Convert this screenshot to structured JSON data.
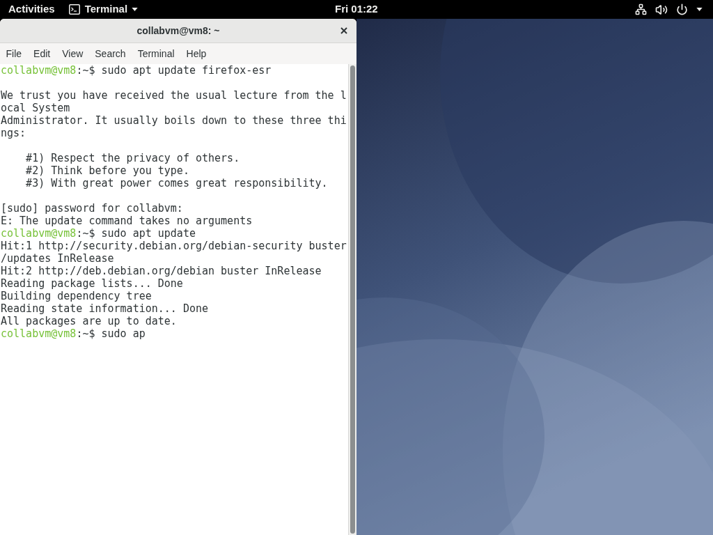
{
  "top_bar": {
    "activities": "Activities",
    "app_menu": "Terminal",
    "clock": "Fri 01:22"
  },
  "window": {
    "title": "collabvm@vm8: ~"
  },
  "menu": [
    "File",
    "Edit",
    "View",
    "Search",
    "Terminal",
    "Help"
  ],
  "terminal": {
    "lines": [
      {
        "kind": "prompt",
        "user_host": "collabvm@vm8",
        "path": ":~$",
        "command": "sudo apt update firefox-esr"
      },
      {
        "kind": "blank"
      },
      {
        "kind": "output",
        "text": "We trust you have received the usual lecture from the l"
      },
      {
        "kind": "output",
        "text": "ocal System"
      },
      {
        "kind": "output",
        "text": "Administrator. It usually boils down to these three thi"
      },
      {
        "kind": "output",
        "text": "ngs:"
      },
      {
        "kind": "blank"
      },
      {
        "kind": "output",
        "text": "    #1) Respect the privacy of others."
      },
      {
        "kind": "output",
        "text": "    #2) Think before you type."
      },
      {
        "kind": "output",
        "text": "    #3) With great power comes great responsibility."
      },
      {
        "kind": "blank"
      },
      {
        "kind": "output",
        "text": "[sudo] password for collabvm:"
      },
      {
        "kind": "output",
        "text": "E: The update command takes no arguments"
      },
      {
        "kind": "prompt",
        "user_host": "collabvm@vm8",
        "path": ":~$",
        "command": "sudo apt update"
      },
      {
        "kind": "output",
        "text": "Hit:1 http://security.debian.org/debian-security buster"
      },
      {
        "kind": "output",
        "text": "/updates InRelease"
      },
      {
        "kind": "output",
        "text": "Hit:2 http://deb.debian.org/debian buster InRelease"
      },
      {
        "kind": "output",
        "text": "Reading package lists... Done"
      },
      {
        "kind": "output",
        "text": "Building dependency tree"
      },
      {
        "kind": "output",
        "text": "Reading state information... Done"
      },
      {
        "kind": "output",
        "text": "All packages are up to date."
      },
      {
        "kind": "prompt",
        "user_host": "collabvm@vm8",
        "path": ":~$",
        "command": "sudo ap"
      }
    ]
  }
}
